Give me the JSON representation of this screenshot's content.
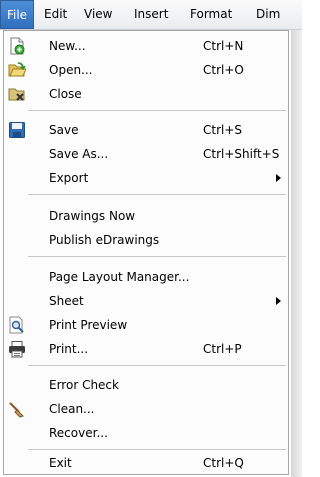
{
  "menubar": {
    "items": [
      "File",
      "Edit",
      "View",
      "Insert",
      "Format",
      "Dim"
    ]
  },
  "file_menu": {
    "new": {
      "label": "New...",
      "shortcut": "Ctrl+N"
    },
    "open": {
      "label": "Open...",
      "shortcut": "Ctrl+O"
    },
    "close": {
      "label": "Close"
    },
    "save": {
      "label": "Save",
      "shortcut": "Ctrl+S"
    },
    "save_as": {
      "label": "Save As...",
      "shortcut": "Ctrl+Shift+S"
    },
    "export": {
      "label": "Export"
    },
    "drawings_now": {
      "label": "Drawings Now"
    },
    "publish_edrawings": {
      "label": "Publish eDrawings"
    },
    "page_layout_manager": {
      "label": "Page Layout Manager..."
    },
    "sheet": {
      "label": "Sheet"
    },
    "print_preview": {
      "label": "Print Preview"
    },
    "print": {
      "label": "Print...",
      "shortcut": "Ctrl+P"
    },
    "error_check": {
      "label": "Error Check"
    },
    "clean": {
      "label": "Clean..."
    },
    "recover": {
      "label": "Recover..."
    },
    "exit": {
      "label": "Exit",
      "shortcut": "Ctrl+Q"
    }
  },
  "icons": {
    "new": "new-document-icon",
    "open": "open-folder-icon",
    "close": "close-document-icon",
    "save": "floppy-disk-icon",
    "print_preview": "magnifier-icon",
    "print": "printer-icon",
    "clean": "broom-icon"
  }
}
